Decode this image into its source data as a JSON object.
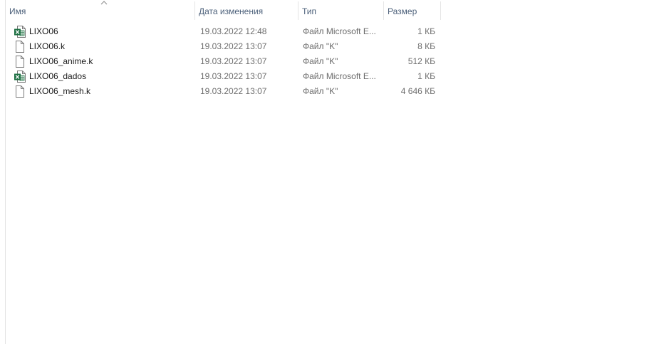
{
  "columns": {
    "name": "Имя",
    "date": "Дата изменения",
    "type": "Тип",
    "size": "Размер"
  },
  "sort": {
    "column": "name",
    "direction": "ascending",
    "icon": "chevron-up-icon"
  },
  "files": [
    {
      "icon": "excel-file-icon",
      "name": "LIXO06",
      "date": "19.03.2022 12:48",
      "type": "Файл Microsoft E...",
      "size": "1 КБ"
    },
    {
      "icon": "generic-file-icon",
      "name": "LIXO06.k",
      "date": "19.03.2022 13:07",
      "type": "Файл \"K\"",
      "size": "8 КБ"
    },
    {
      "icon": "generic-file-icon",
      "name": "LIXO06_anime.k",
      "date": "19.03.2022 13:07",
      "type": "Файл \"K\"",
      "size": "512 КБ"
    },
    {
      "icon": "excel-file-icon",
      "name": "LIXO06_dados",
      "date": "19.03.2022 13:07",
      "type": "Файл Microsoft E...",
      "size": "1 КБ"
    },
    {
      "icon": "generic-file-icon",
      "name": "LIXO06_mesh.k",
      "date": "19.03.2022 13:07",
      "type": "Файл \"K\"",
      "size": "4 646 КБ"
    }
  ],
  "colors": {
    "header_text": "#4c607a",
    "detail_text": "#6d6d6d",
    "excel_green": "#1d6f42"
  }
}
